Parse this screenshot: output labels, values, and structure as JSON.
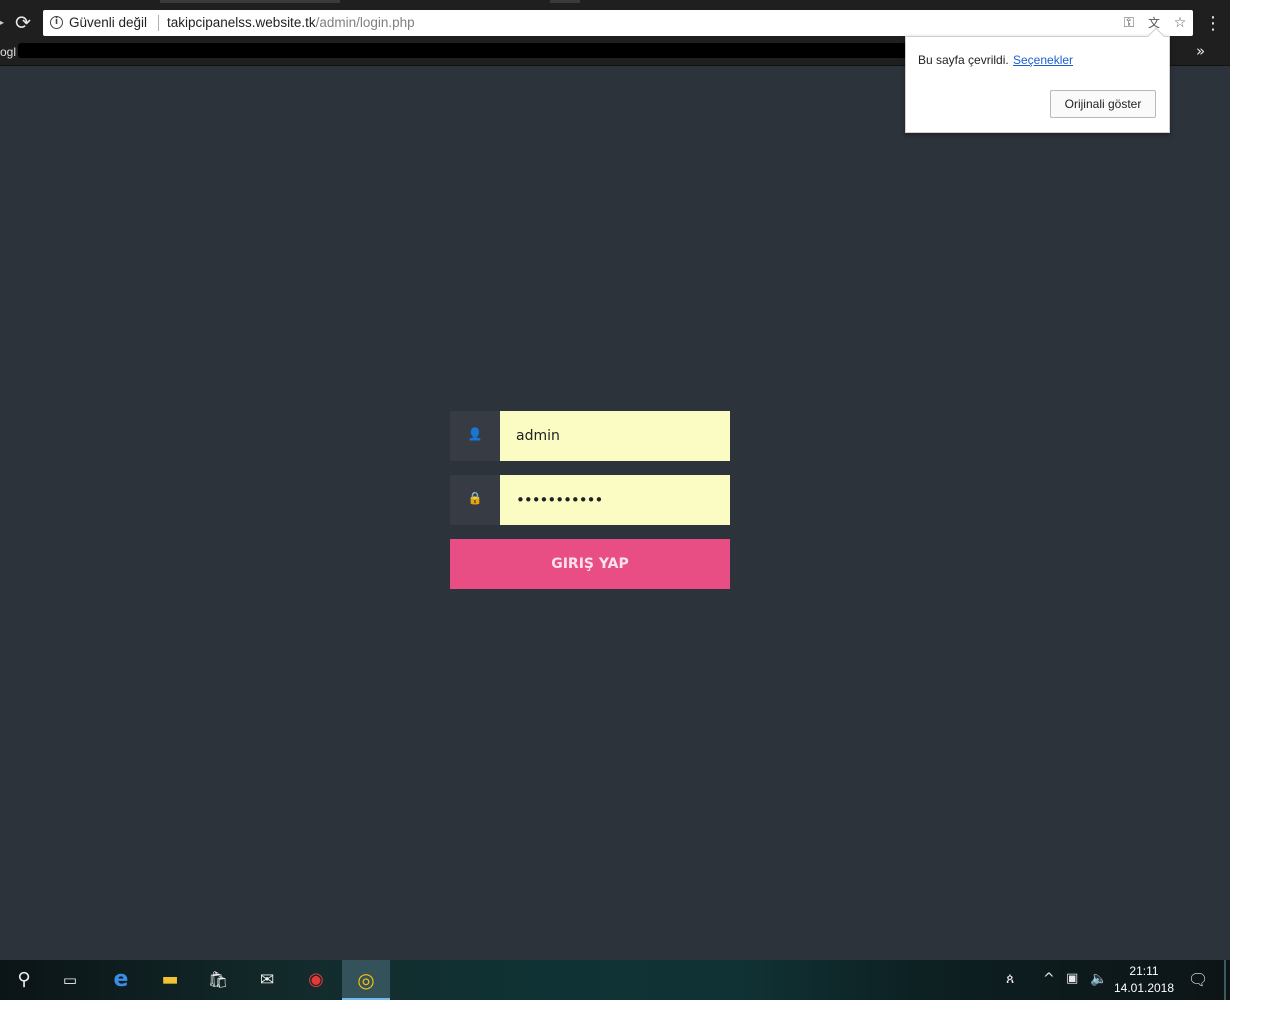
{
  "browser": {
    "security_label": "Güvenli değil",
    "url_host": "takipcipanelss.website.tk",
    "url_path": "/admin/login.php",
    "bookmarks_partial_label": "ogl"
  },
  "translate_popup": {
    "message": "Bu sayfa çevrildi.",
    "options_link": "Seçenekler",
    "show_original_button": "Orijinali göster"
  },
  "login": {
    "username_value": "admin",
    "password_value": "•••••••••••",
    "submit_label": "GIRIŞ YAP"
  },
  "taskbar": {
    "time": "21:11",
    "date": "14.01.2018",
    "pinned_apps": [
      "search-icon",
      "task-view-icon",
      "edge-icon",
      "file-explorer-icon",
      "store-icon",
      "mail-icon",
      "antivirus-icon",
      "chrome-icon"
    ],
    "active_app": "chrome-icon"
  },
  "colors": {
    "page_background": "#2d333b",
    "input_background": "#fafcc4",
    "button_accent": "#e84d84",
    "browser_chrome": "#1f1f1f"
  }
}
